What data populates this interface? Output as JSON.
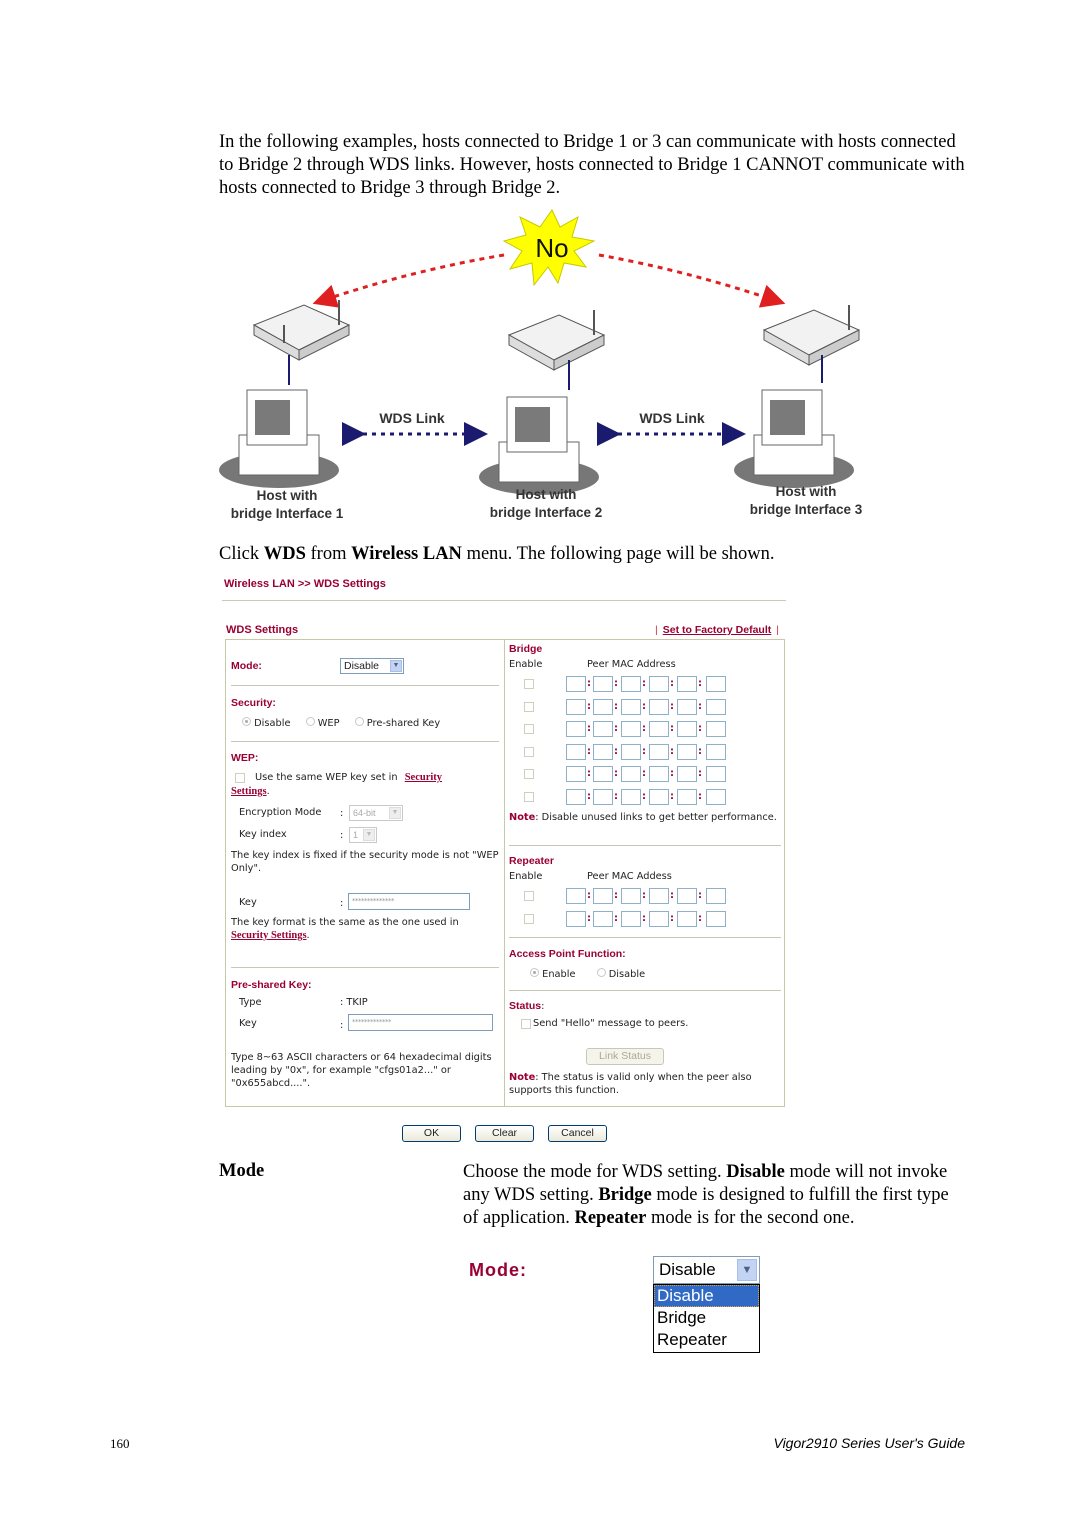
{
  "intro_paragraph": "In the following examples, hosts connected to Bridge 1 or 3 can communicate with hosts connected to Bridge 2 through WDS links. However, hosts connected to Bridge 1 CANNOT communicate with hosts connected to Bridge 3 through Bridge 2.",
  "diagram": {
    "no_label": "No",
    "wds_link_1": "WDS Link",
    "wds_link_2": "WDS Link",
    "host1_line1": "Host with",
    "host1_line2": "bridge Interface 1",
    "host2_line1": "Host with",
    "host2_line2": "bridge Interface 2",
    "host3_line1": "Host with",
    "host3_line2": "bridge Interface 3",
    "colors": {
      "no_burst": "#ffff00",
      "red_arrow": "#e02020",
      "blue_arrow": "#1a1a6e"
    }
  },
  "click_sentence": {
    "prefix": "Click ",
    "b1": "WDS",
    "mid": " from ",
    "b2": "Wireless LAN",
    "suffix": " menu. The following page will be shown."
  },
  "ui": {
    "breadcrumb": "Wireless LAN >> WDS Settings",
    "section_title": "WDS Settings",
    "factory_default": "Set to Factory Default",
    "mode_label": "Mode:",
    "mode_value": "Disable",
    "security_label": "Security:",
    "security_options": [
      "Disable",
      "WEP",
      "Pre-shared Key"
    ],
    "security_selected": "Disable",
    "wep_label": "WEP:",
    "wep_same_key_text": "Use the same WEP key set in",
    "wep_security_link1": "Security",
    "wep_security_link2": "Settings",
    "wep_period": ".",
    "encryption_mode_label": "Encryption Mode",
    "encryption_mode_value": "64-bit",
    "key_index_label": "Key index",
    "key_index_value": "1",
    "colon": ":",
    "key_index_note": "The key index is fixed if the security mode is not \"WEP Only\".",
    "key_label": "Key",
    "key_value": "**************",
    "key_format_note": "The key format is the same as the one used in",
    "key_format_link": "Security Settings",
    "psk_label": "Pre-shared Key:",
    "psk_type_label": "Type",
    "psk_type_value": ": TKIP",
    "psk_key_label": "Key",
    "psk_key_value": "*************",
    "psk_note": "Type 8~63 ASCII characters or 64 hexadecimal digits leading by \"0x\", for example \"cfgs01a2...\" or \"0x655abcd....\".",
    "bridge_label": "Bridge",
    "bridge_enable_header": "Enable",
    "bridge_mac_header": "Peer MAC Address",
    "bridge_rows": 6,
    "bridge_note_label": "Note",
    "bridge_note_text": ": Disable unused links to get better performance.",
    "repeater_label": "Repeater",
    "repeater_enable_header": "Enable",
    "repeater_mac_header": "Peer MAC Addess",
    "repeater_rows": 2,
    "ap_function_label": "Access Point Function:",
    "ap_options": [
      "Enable",
      "Disable"
    ],
    "ap_selected": "Enable",
    "status_label": "Status",
    "status_colon": ":",
    "hello_text": "Send \"Hello\" message to peers.",
    "link_status_button": "Link Status",
    "status_note_label": "Note",
    "status_note_text": ": The status is valid only when the peer also supports this function.",
    "ok_button": "OK",
    "clear_button": "Clear",
    "cancel_button": "Cancel",
    "accent_color": "#990033"
  },
  "mode_description": {
    "term": "Mode",
    "t1": "Choose the mode for WDS setting. ",
    "b1": "Disable",
    "t2": " mode will not invoke any WDS setting. ",
    "b2": "Bridge",
    "t3": " mode is designed to fulfill the first type of application. ",
    "b3": "Repeater",
    "t4": " mode is for the second one."
  },
  "mode_dropdown": {
    "label": "Mode:",
    "value": "Disable",
    "options": [
      "Disable",
      "Bridge",
      "Repeater"
    ],
    "highlighted": "Disable"
  },
  "footer": {
    "page_number": "160",
    "guide_title": "Vigor2910  Series  User's  Guide"
  }
}
